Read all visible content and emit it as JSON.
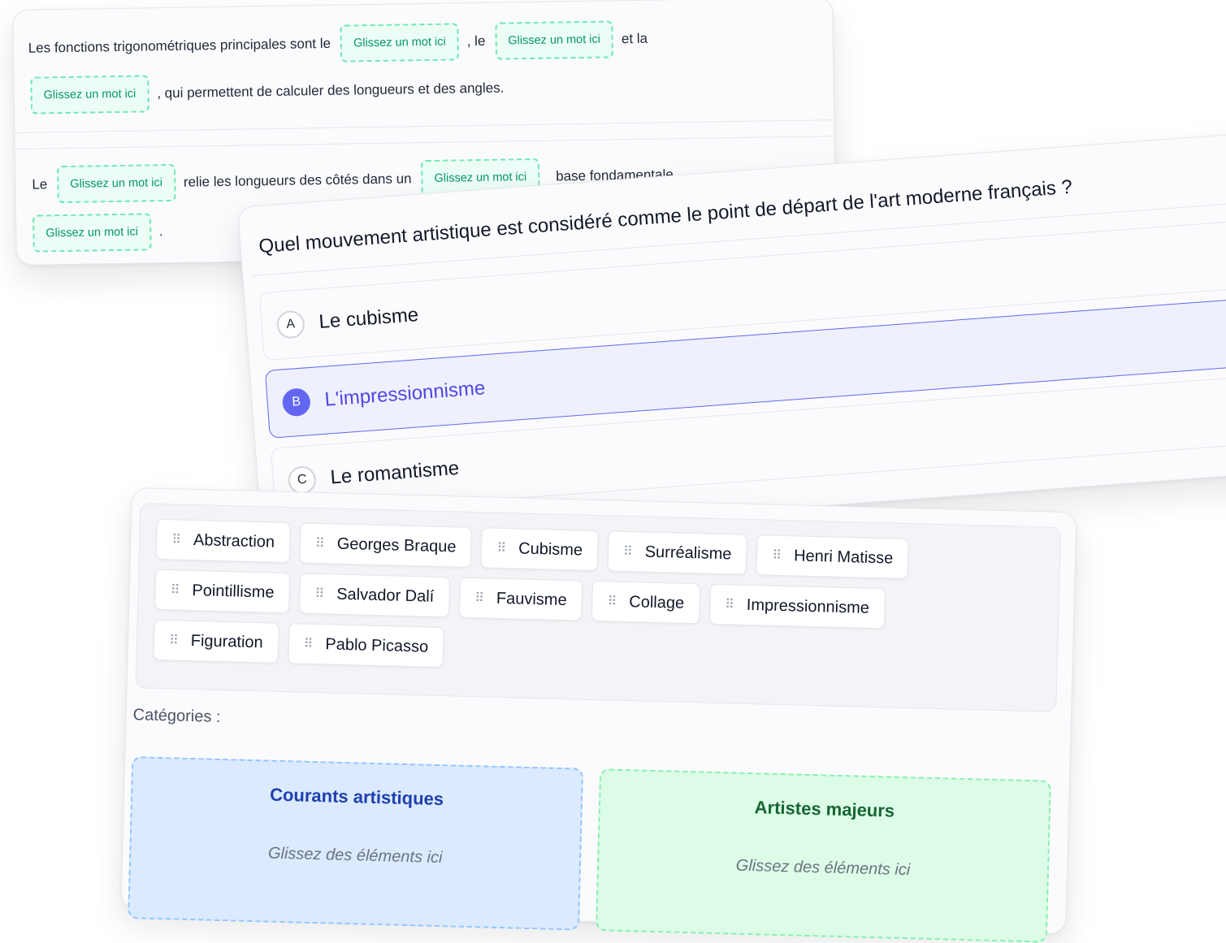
{
  "fill_blank": {
    "sentence1": {
      "part1": "Les fonctions trigonométriques principales sont le",
      "part2": ", le",
      "part3": "et la",
      "part4": ", qui permettent de calculer des longueurs et des angles."
    },
    "sentence2": {
      "part1": "Le",
      "part2": "relie les longueurs des côtés dans un",
      "part3": "base fondamentale",
      "part4": "."
    },
    "drop_placeholder": "Glissez un mot ici"
  },
  "quiz": {
    "question": "Quel mouvement artistique est considéré comme le point de départ de l'art moderne français ?",
    "options": [
      {
        "letter": "A",
        "text": "Le cubisme"
      },
      {
        "letter": "B",
        "text": "L'impressionnisme"
      },
      {
        "letter": "C",
        "text": "Le romantisme"
      }
    ],
    "selected": "B"
  },
  "sorting": {
    "items": [
      "Abstraction",
      "Georges Braque",
      "Cubisme",
      "Surréalisme",
      "Henri Matisse",
      "Pointillisme",
      "Salvador Dalí",
      "Fauvisme",
      "Collage",
      "Impressionnisme",
      "Figuration",
      "Pablo Picasso"
    ],
    "categories_label": "Catégories :",
    "categories": [
      {
        "name": "Courants artistiques",
        "hint": "Glissez des éléments ici"
      },
      {
        "name": "Artistes majeurs",
        "hint": "Glissez des éléments ici"
      }
    ]
  },
  "colors": {
    "accent": "#6366f1",
    "drop_border": "#6ee7b7",
    "category_blue": "#dbeafe",
    "category_green": "#dcfce7"
  },
  "icons": {
    "drag_handle": "grip-dots-icon"
  }
}
